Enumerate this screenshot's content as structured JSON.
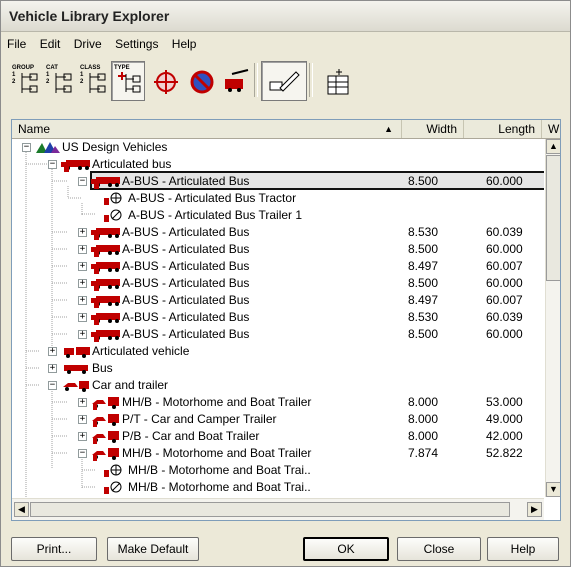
{
  "window": {
    "title": "Vehicle Library Explorer"
  },
  "menu": [
    "File",
    "Edit",
    "Drive",
    "Settings",
    "Help"
  ],
  "toolbar": {
    "group": [
      "GROUP",
      "1",
      "2"
    ],
    "cat": [
      "CAT",
      "1",
      "2"
    ],
    "class": [
      "CLASS",
      "1",
      "2"
    ],
    "type": [
      "TYPE"
    ]
  },
  "columns": {
    "name": "Name",
    "width": "Width",
    "length": "Length",
    "extra": "W"
  },
  "rows": [
    {
      "label": "US Design Vehicles",
      "width": "",
      "length": ""
    },
    {
      "label": "Articulated bus",
      "width": "",
      "length": ""
    },
    {
      "label": "A-BUS - Articulated Bus",
      "width": "8.500",
      "length": "60.000"
    },
    {
      "label": "A-BUS - Articulated Bus Tractor",
      "width": "",
      "length": ""
    },
    {
      "label": "A-BUS - Articulated Bus Trailer 1",
      "width": "",
      "length": ""
    },
    {
      "label": "A-BUS - Articulated Bus",
      "width": "8.530",
      "length": "60.039"
    },
    {
      "label": "A-BUS - Articulated Bus",
      "width": "8.500",
      "length": "60.000"
    },
    {
      "label": "A-BUS - Articulated Bus",
      "width": "8.497",
      "length": "60.007"
    },
    {
      "label": "A-BUS - Articulated Bus",
      "width": "8.500",
      "length": "60.000"
    },
    {
      "label": "A-BUS - Articulated Bus",
      "width": "8.497",
      "length": "60.007"
    },
    {
      "label": "A-BUS - Articulated Bus",
      "width": "8.530",
      "length": "60.039"
    },
    {
      "label": "A-BUS - Articulated Bus",
      "width": "8.500",
      "length": "60.000"
    },
    {
      "label": "Articulated vehicle",
      "width": "",
      "length": ""
    },
    {
      "label": "Bus",
      "width": "",
      "length": ""
    },
    {
      "label": "Car and trailer",
      "width": "",
      "length": ""
    },
    {
      "label": "MH/B - Motorhome and Boat Trailer",
      "width": "8.000",
      "length": "53.000"
    },
    {
      "label": "P/T - Car and Camper Trailer",
      "width": "8.000",
      "length": "49.000"
    },
    {
      "label": "P/B - Car and Boat Trailer",
      "width": "8.000",
      "length": "42.000"
    },
    {
      "label": "MH/B - Motorhome and Boat Trailer",
      "width": "7.874",
      "length": "52.822"
    },
    {
      "label": "MH/B - Motorhome and Boat Trai..",
      "width": "",
      "length": ""
    },
    {
      "label": "MH/B - Motorhome and Boat Trai..",
      "width": "",
      "length": ""
    }
  ],
  "buttons": {
    "print": "Print...",
    "make_default": "Make Default",
    "ok": "OK",
    "close": "Close",
    "help": "Help"
  },
  "colors": {
    "vehicle_red": "#c00000",
    "tree_line": "#a0a0a0"
  }
}
